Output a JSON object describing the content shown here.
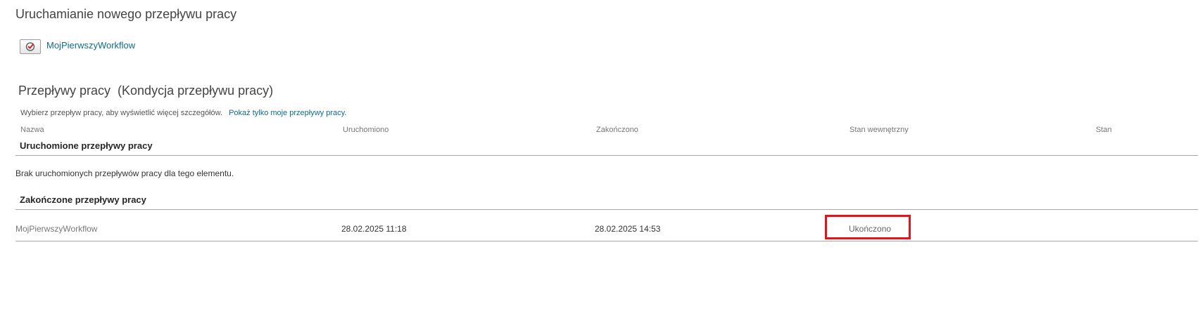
{
  "start_section": {
    "title": "Uruchamianie nowego przepływu pracy",
    "workflow_link": "MojPierwszyWorkflow",
    "icon": "workflow-start-icon"
  },
  "workflows_section": {
    "title": "Przepływy pracy  (Kondycja przepływu pracy)",
    "hint": "Wybierz przepływ pracy, aby wyświetlić więcej szczegółów.",
    "show_mine_link": "Pokaż tylko moje przepływy pracy.",
    "columns": [
      "Nazwa",
      "Uruchomiono",
      "Zakończono",
      "Stan wewnętrzny",
      "Stan"
    ],
    "running": {
      "heading": "Uruchomione przepływy pracy",
      "empty_message": "Brak uruchomionych przepływów pracy dla tego elementu."
    },
    "completed": {
      "heading": "Zakończone przepływy pracy",
      "rows": [
        {
          "name": "MojPierwszyWorkflow",
          "started": "28.02.2025 11:18",
          "ended": "28.02.2025 14:53",
          "internal_state": "Ukończono",
          "state": ""
        }
      ]
    }
  },
  "colors": {
    "link": "#0f6b8a",
    "highlight": "#e0141c"
  }
}
